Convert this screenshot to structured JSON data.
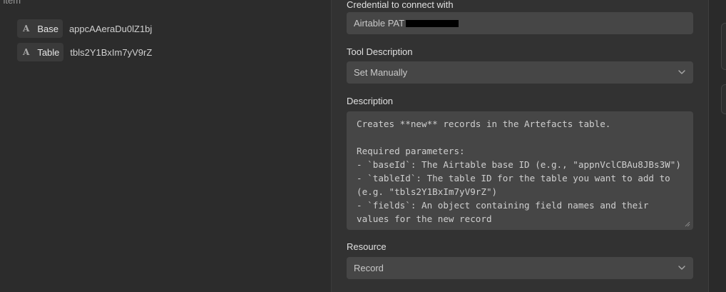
{
  "left": {
    "header": "l item",
    "items": [
      {
        "type_icon": "A",
        "label": "Base",
        "value": "appcAAeraDu0lZ1bj"
      },
      {
        "type_icon": "A",
        "label": "Table",
        "value": "tbls2Y1BxIm7yV9rZ"
      }
    ]
  },
  "form": {
    "credential": {
      "label": "Credential to connect with",
      "value": "Airtable PAT"
    },
    "tool_description": {
      "label": "Tool Description",
      "value": "Set Manually"
    },
    "description": {
      "label": "Description",
      "value": "Creates **new** records in the Artefacts table.\n\nRequired parameters:\n- `baseId`: The Airtable base ID (e.g., \"appnVclCBAu8JBs3W\")\n- `tableId`: The table ID for the table you want to add to\n(e.g. \"tbls2Y1BxIm7yV9rZ\")\n- `fields`: An object containing field names and their\nvalues for the new record"
    },
    "resource": {
      "label": "Resource",
      "value": "Record"
    }
  },
  "icons": {
    "dropdown": "chevron-down-icon",
    "resize": "resize-handle-icon",
    "field_type": "text-type-icon"
  },
  "colors": {
    "background": "#2c2c2c",
    "panel": "#323232",
    "field": "#464646",
    "text": "#d6d6d6"
  }
}
